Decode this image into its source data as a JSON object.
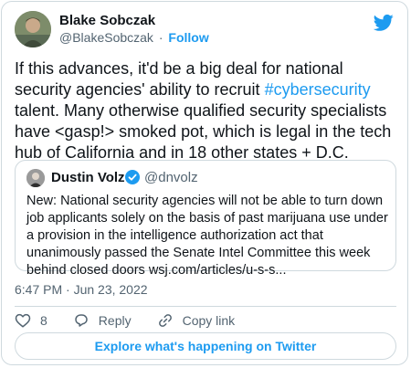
{
  "author": {
    "name": "Blake Sobczak",
    "handle": "@BlakeSobczak",
    "separator": "·",
    "follow_label": "Follow"
  },
  "tweet": {
    "text_before": "If this advances, it'd be a big deal for national security agencies' ability to recruit ",
    "hashtag": "#cybersecurity",
    "text_after": " talent. Many otherwise qualified security specialists have <gasp!> smoked pot, which is legal in the tech hub of California and in 18 other states + D.C."
  },
  "quoted_tweet": {
    "name": "Dustin Volz",
    "handle": "@dnvolz",
    "text": "New: National security agencies will not be able to turn down job applicants solely on the basis of past marijuana use under a provision in the intelligence authorization act that unanimously passed the Senate Intel Committee this week behind closed doors wsj.com/articles/u-s-s..."
  },
  "timestamp": "6:47 PM · Jun 23, 2022",
  "actions": {
    "like_count": "8",
    "reply_label": "Reply",
    "copy_link_label": "Copy link"
  },
  "explore_label": "Explore what's happening on Twitter",
  "colors": {
    "accent": "#1d9bf0",
    "text": "#0f1419",
    "muted": "#536471",
    "border": "#cfd9de"
  }
}
